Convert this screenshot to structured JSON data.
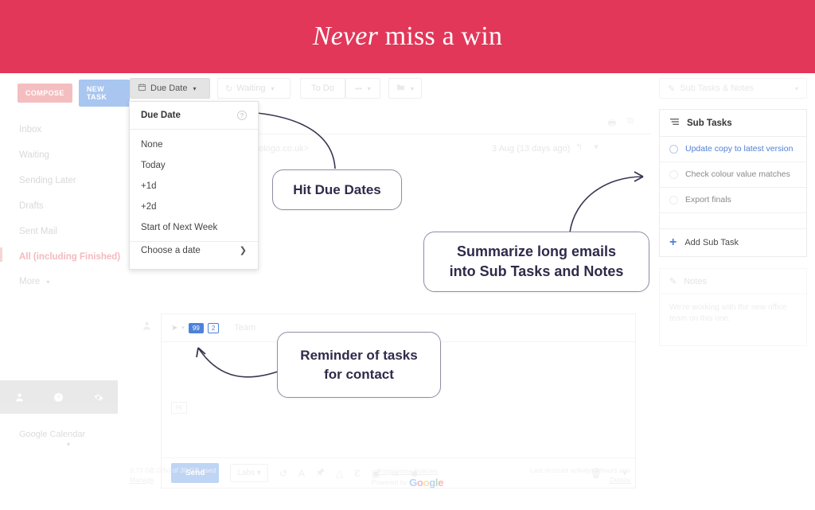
{
  "banner": {
    "title_italic": "Never",
    "title_rest": " miss a win"
  },
  "sidebar": {
    "compose_label": "COMPOSE",
    "new_task_label": "NEW TASK",
    "items": [
      {
        "label": "Inbox"
      },
      {
        "label": "Waiting"
      },
      {
        "label": "Sending Later"
      },
      {
        "label": "Drafts"
      },
      {
        "label": "Sent Mail"
      },
      {
        "label": "All (including Finished)"
      }
    ],
    "more_label": "More",
    "more_caret": "▾",
    "icons": [
      {
        "name": "person-icon",
        "glyph": "👤"
      },
      {
        "name": "help-icon",
        "glyph": "?"
      },
      {
        "name": "settings-gear-icon",
        "glyph": "✿"
      }
    ],
    "calendar_label": "Google Calendar",
    "calendar_caret": "▾"
  },
  "toolbar": {
    "due_date": {
      "icon": "📅",
      "label": "Due Date",
      "caret": "▾"
    },
    "waiting": {
      "icon": "↻",
      "label": "Waiting",
      "caret": "▾"
    },
    "todo": {
      "label": "To Do"
    },
    "more": {
      "label": "•••",
      "caret": "▾"
    },
    "folder": {
      "icon": "▰",
      "caret": "▾"
    },
    "subtasks_toggle": {
      "icon": "✎",
      "label": "Sub Tasks & Notes",
      "caret": "▾"
    }
  },
  "due_date_menu": {
    "header": "Due Date",
    "help_glyph": "?",
    "items": [
      "None",
      "Today",
      "+1d",
      "+2d",
      "Start of Next Week"
    ],
    "choose": "Choose a date",
    "choose_chevron": "❯"
  },
  "mail": {
    "from": "ogologo.co.uk>",
    "date": "3 Aug (13 days ago)",
    "print_icon": "🖶",
    "popout_icon": "⧉",
    "reply_icon": "↰",
    "menu_icon": "▾"
  },
  "compose": {
    "avatar_icon": "person-icon",
    "badge_1": "99",
    "badge_2": "2",
    "recipient": "Team",
    "body_tag": "Hi",
    "send_label": "Send",
    "labs_label": "Labs",
    "labs_caret": "▾",
    "tools": [
      {
        "name": "undo-icon",
        "glyph": "↺",
        "caret": "▾"
      },
      {
        "name": "format-text-icon",
        "glyph": "A"
      },
      {
        "name": "attach-icon",
        "glyph": "🖈"
      },
      {
        "name": "drive-icon",
        "glyph": "△"
      },
      {
        "name": "signature-icon",
        "glyph": "Ɛ"
      },
      {
        "name": "photo-icon",
        "glyph": "▣"
      },
      {
        "name": "link-icon",
        "glyph": "∞"
      },
      {
        "name": "emoji-icon",
        "glyph": "☻"
      }
    ],
    "trash_icon": "🗑",
    "more_icon": "▾"
  },
  "subtasks": {
    "panel_title": "Sub Tasks",
    "menu_icon": "≡",
    "items": [
      {
        "text": "Update copy to latest version",
        "highlighted": true
      },
      {
        "text": "Check colour value matches",
        "highlighted": false
      },
      {
        "text": "Export finals",
        "highlighted": false
      }
    ],
    "add_label": "Add Sub Task",
    "add_plus": "+"
  },
  "notes": {
    "title": "Notes",
    "pencil_icon": "✎",
    "body": "We're working with the new office team on this one."
  },
  "footer": {
    "storage": "0.73 GB (2%) of 30 GB used",
    "manage": "Manage",
    "policies": "Programme Policies",
    "powered_by": "Powered by",
    "google_g": "G",
    "google_o1": "o",
    "google_o2": "o",
    "google_g2": "g",
    "google_l": "l",
    "google_e": "e",
    "activity": "Last account activity: 2 hours ago",
    "details": "Details"
  },
  "annotations": {
    "due_dates": "Hit Due Dates",
    "summarize_line1": "Summarize long emails",
    "summarize_line2": "into Sub Tasks and Notes",
    "reminder_line1": "Reminder of tasks",
    "reminder_line2": "for contact"
  },
  "colors": {
    "banner": "#E23759",
    "callout_border": "#8f8fa6",
    "callout_text": "#2e2b4a",
    "link_blue": "#4f7fd6",
    "compose_pink": "#f3b3b6",
    "newtask_blue": "#9fc0ef"
  }
}
